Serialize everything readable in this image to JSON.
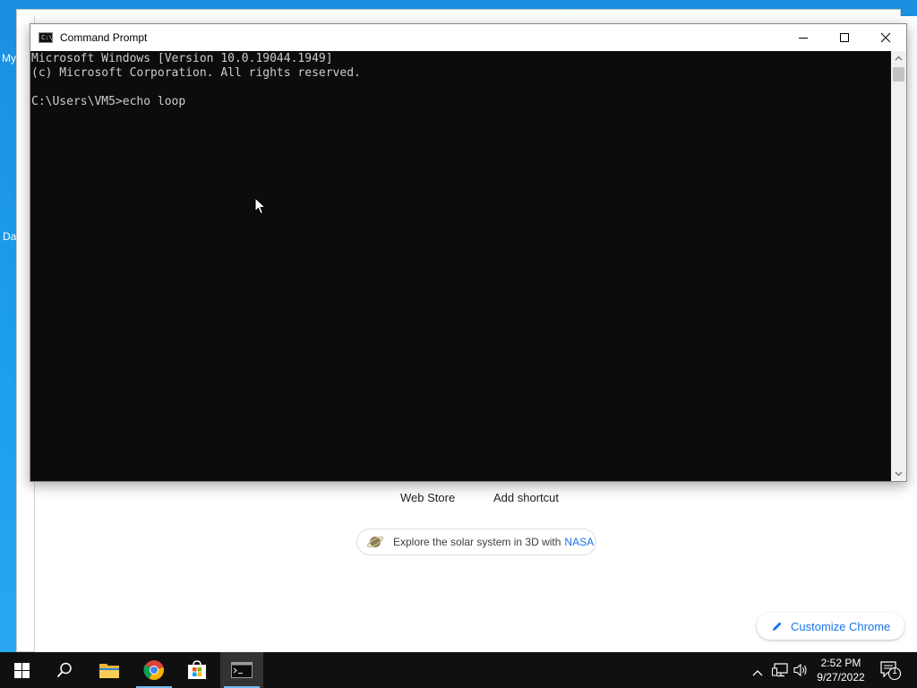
{
  "desktop": {
    "icon_labels": [
      "My",
      "Da"
    ]
  },
  "chrome": {
    "links": {
      "web_store": "Web Store",
      "add_shortcut": "Add shortcut"
    },
    "nasa_chip": {
      "prefix": "Explore the solar system in 3D with",
      "link": "NASA"
    },
    "customize": "Customize Chrome"
  },
  "cmd": {
    "title": "Command Prompt",
    "icon_text": "C:\\_",
    "lines": [
      "Microsoft Windows [Version 10.0.19044.1949]",
      "(c) Microsoft Corporation. All rights reserved.",
      "",
      "C:\\Users\\VM5>echo loop"
    ]
  },
  "taskbar": {
    "apps": [
      "start-icon",
      "search-icon",
      "file-explorer-icon",
      "chrome-icon",
      "store-icon",
      "cmd-icon"
    ],
    "clock": {
      "time": "2:52 PM",
      "date": "9/27/2022"
    },
    "notification_count": "1"
  },
  "colors": {
    "desktop": "#1da0ee",
    "console_bg": "#0c0c0c",
    "console_text": "#cccccc",
    "taskbar": "#101010",
    "chrome_accent": "#1a73e8"
  }
}
